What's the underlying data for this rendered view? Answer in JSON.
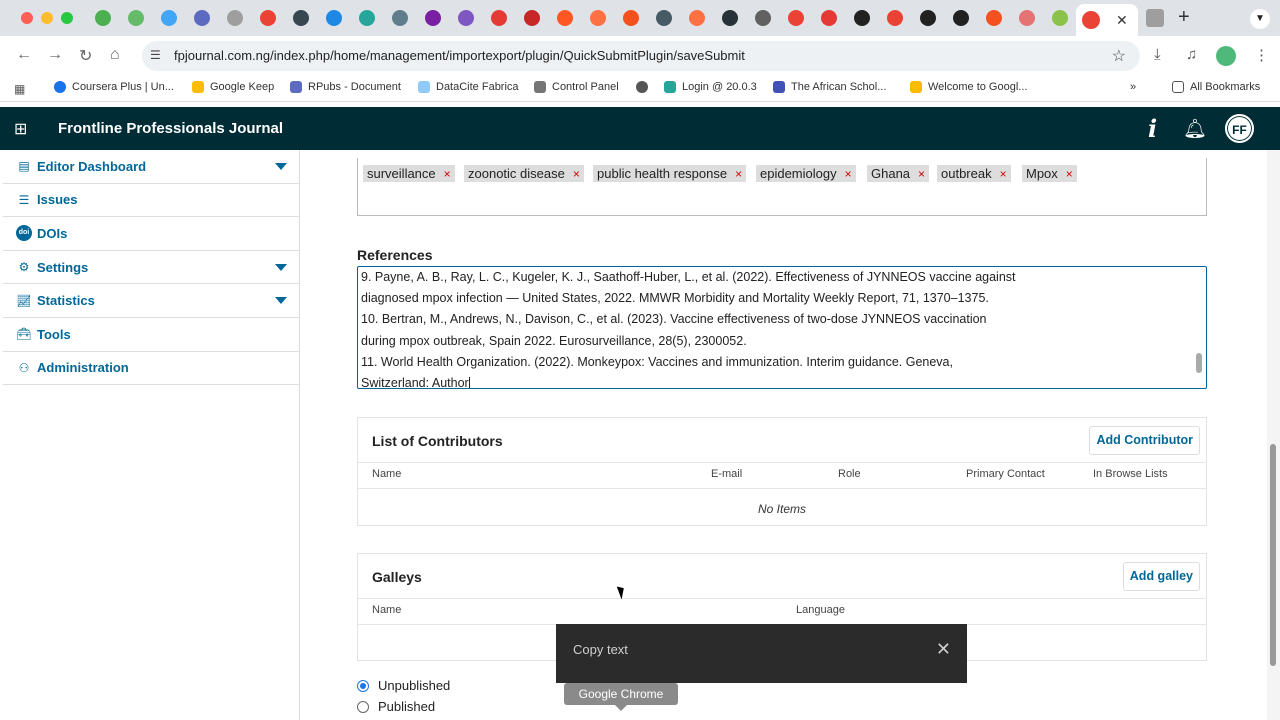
{
  "browser": {
    "url": "fpjournal.com.ng/index.php/home/management/importexport/plugin/QuickSubmitPlugin/saveSubmit",
    "tab_favicon_colors": [
      "#4caf50",
      "#66bb6a",
      "#42a5f5",
      "#5c6bc0",
      "#9e9e9e",
      "#ea4335",
      "#37474f",
      "#1e88e5",
      "#26a69a",
      "#607d8b",
      "#7b1fa2",
      "#7e57c2",
      "#e53935",
      "#c62828",
      "#ff5722",
      "#ff7043",
      "#f4511e",
      "#455a64",
      "#ff7043",
      "#263238",
      "#616161",
      "#ea4335",
      "#e53935",
      "#212121",
      "#ea4335",
      "#212121",
      "#212121",
      "#f4511e",
      "#e57373",
      "#8bc34a"
    ],
    "bookmarks": [
      {
        "label": "Coursera Plus | Un...",
        "color": "#1a73e8"
      },
      {
        "label": "Google Keep",
        "color": "#fbbc04"
      },
      {
        "label": "RPubs - Document",
        "color": "#5c6bc0"
      },
      {
        "label": "DataCite Fabrica",
        "color": "#90caf9"
      },
      {
        "label": "Control Panel",
        "color": "#757575"
      },
      {
        "label": "",
        "color": "#555555"
      },
      {
        "label": "Login @ 20.0.3",
        "color": "#26a69a"
      },
      {
        "label": "The African Schol...",
        "color": "#3f51b5"
      },
      {
        "label": "Welcome to Googl...",
        "color": "#fbbc04"
      }
    ],
    "all_bookmarks_label": "All Bookmarks"
  },
  "app": {
    "title": "Frontline Professionals Journal",
    "avatar_initials": "FF"
  },
  "sidebar": {
    "items": [
      {
        "label": "Editor Dashboard",
        "icon": "grid-icon",
        "caret": true
      },
      {
        "label": "Issues",
        "icon": "list-icon",
        "caret": false
      },
      {
        "label": "DOIs",
        "icon": "doi-icon",
        "caret": false
      },
      {
        "label": "Settings",
        "icon": "gear-icon",
        "caret": true
      },
      {
        "label": "Statistics",
        "icon": "chart-icon",
        "caret": true
      },
      {
        "label": "Tools",
        "icon": "toolbox-icon",
        "caret": false
      },
      {
        "label": "Administration",
        "icon": "admin-icon",
        "caret": false
      }
    ],
    "doi_badge": "doi"
  },
  "keywords": [
    "surveillance",
    "zoonotic disease",
    "public health response",
    "epidemiology",
    "Ghana",
    "outbreak",
    "Mpox"
  ],
  "keyword_remove_glyph": "×",
  "references": {
    "label": "References",
    "lines": [
      "9. Payne, A. B., Ray, L. C., Kugeler, K. J., Saathoff-Huber, L., et al. (2022). Effectiveness of JYNNEOS vaccine against",
      "diagnosed mpox infection — United States, 2022. MMWR Morbidity and Mortality Weekly Report, 71, 1370–1375.",
      "10. Bertran, M., Andrews, N., Davison, C., et al. (2023). Vaccine effectiveness of two-dose JYNNEOS vaccination",
      "during mpox outbreak, Spain 2022. Eurosurveillance, 28(5), 2300052.",
      "11. World Health Organization. (2022). Monkeypox: Vaccines and immunization. Interim guidance. Geneva,",
      "Switzerland: Author"
    ]
  },
  "contributors": {
    "title": "List of Contributors",
    "add_label": "Add Contributor",
    "columns": [
      "Name",
      "E-mail",
      "Role",
      "Primary Contact",
      "In Browse Lists"
    ],
    "empty": "No Items"
  },
  "galleys": {
    "title": "Galleys",
    "add_label": "Add galley",
    "columns": [
      "Name",
      "Language"
    ]
  },
  "status": {
    "options": [
      "Unpublished",
      "Published"
    ],
    "selected": "Unpublished"
  },
  "toast": {
    "text": "Copy text",
    "close_glyph": "✕"
  },
  "tooltip": {
    "text": "Google Chrome"
  }
}
